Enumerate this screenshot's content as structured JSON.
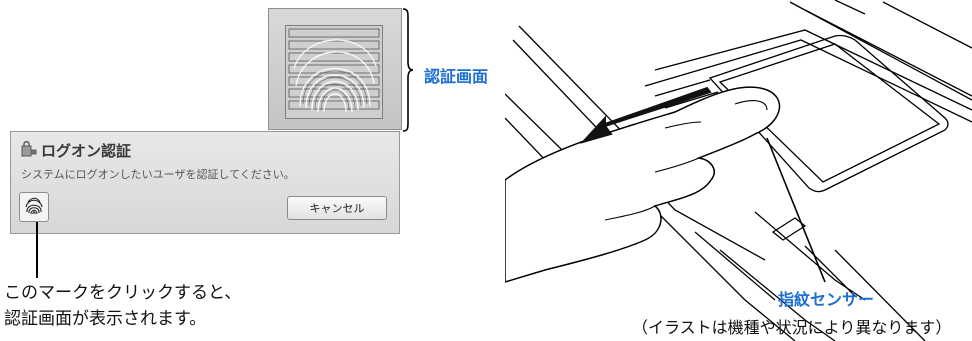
{
  "auth_screen": {
    "label": "認証画面"
  },
  "logon_dialog": {
    "title": "ログオン認証",
    "message": "システムにログオンしたいユーザを認証してください。",
    "fingerprint_button_icon": "fingerprint-icon",
    "cancel_label": "キャンセル"
  },
  "caption_left": {
    "line1": "このマークをクリックすると、",
    "line2": "認証画面が表示されます。"
  },
  "illustration": {
    "sensor_label": "指紋センサー",
    "note": "（イラストは機種や状況により異なります）"
  },
  "colors": {
    "label_blue": "#1d6fd1"
  }
}
